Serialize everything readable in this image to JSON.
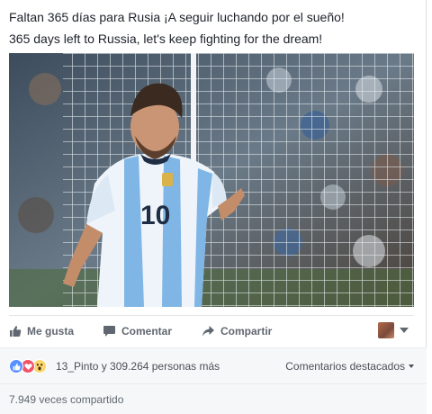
{
  "post": {
    "text_line1": "Faltan 365 días para Rusia ¡A seguir luchando por el sueño!",
    "text_line2": "365 days left to Russia, let's keep fighting for the dream!",
    "photo_jersey_number": "10"
  },
  "actions": {
    "like_label": "Me gusta",
    "comment_label": "Comentar",
    "share_label": "Compartir",
    "like_icon": "thumbs-up-icon",
    "comment_icon": "speech-bubble-icon",
    "share_icon": "share-arrow-icon"
  },
  "reactions": {
    "summary": "13_Pinto y 309.264 personas más",
    "icons": [
      "like-reaction-icon",
      "love-reaction-icon",
      "wow-reaction-icon"
    ],
    "featured_comments_label": "Comentarios destacados"
  },
  "shares": {
    "summary": "7.949 veces compartido"
  },
  "colors": {
    "accent": "#4267b2",
    "like": "#5890ff",
    "love": "#f25268",
    "wow": "#fcd669",
    "text_secondary": "#606770"
  }
}
